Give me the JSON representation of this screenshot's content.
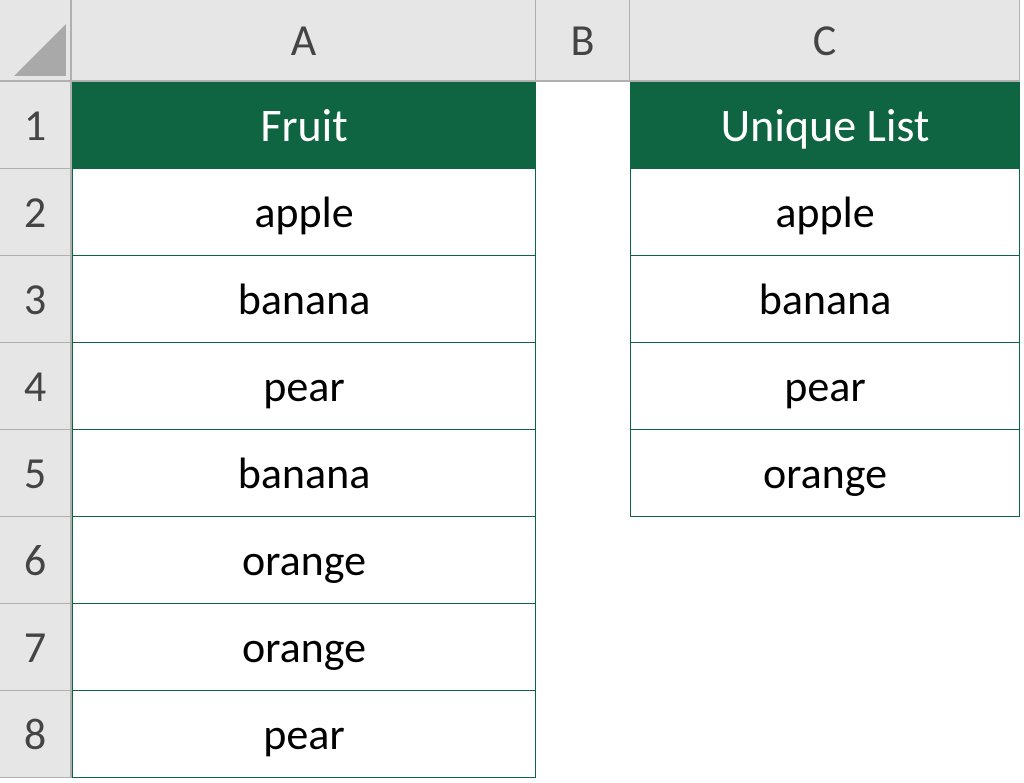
{
  "columns": [
    "A",
    "B",
    "C"
  ],
  "rows": [
    "1",
    "2",
    "3",
    "4",
    "5",
    "6",
    "7",
    "8"
  ],
  "colA": {
    "header": "Fruit",
    "values": [
      "apple",
      "banana",
      "pear",
      "banana",
      "orange",
      "orange",
      "pear"
    ]
  },
  "colC": {
    "header": "Unique List",
    "values": [
      "apple",
      "banana",
      "pear",
      "orange"
    ]
  }
}
